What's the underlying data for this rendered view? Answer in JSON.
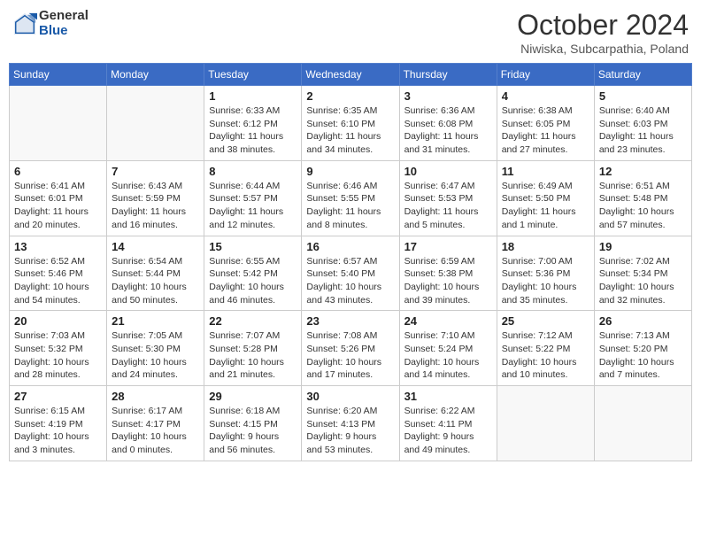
{
  "header": {
    "logo_general": "General",
    "logo_blue": "Blue",
    "month_title": "October 2024",
    "subtitle": "Niwiska, Subcarpathia, Poland"
  },
  "days_of_week": [
    "Sunday",
    "Monday",
    "Tuesday",
    "Wednesday",
    "Thursday",
    "Friday",
    "Saturday"
  ],
  "weeks": [
    [
      {
        "day": "",
        "info": ""
      },
      {
        "day": "",
        "info": ""
      },
      {
        "day": "1",
        "sunrise": "Sunrise: 6:33 AM",
        "sunset": "Sunset: 6:12 PM",
        "daylight": "Daylight: 11 hours and 38 minutes."
      },
      {
        "day": "2",
        "sunrise": "Sunrise: 6:35 AM",
        "sunset": "Sunset: 6:10 PM",
        "daylight": "Daylight: 11 hours and 34 minutes."
      },
      {
        "day": "3",
        "sunrise": "Sunrise: 6:36 AM",
        "sunset": "Sunset: 6:08 PM",
        "daylight": "Daylight: 11 hours and 31 minutes."
      },
      {
        "day": "4",
        "sunrise": "Sunrise: 6:38 AM",
        "sunset": "Sunset: 6:05 PM",
        "daylight": "Daylight: 11 hours and 27 minutes."
      },
      {
        "day": "5",
        "sunrise": "Sunrise: 6:40 AM",
        "sunset": "Sunset: 6:03 PM",
        "daylight": "Daylight: 11 hours and 23 minutes."
      }
    ],
    [
      {
        "day": "6",
        "sunrise": "Sunrise: 6:41 AM",
        "sunset": "Sunset: 6:01 PM",
        "daylight": "Daylight: 11 hours and 20 minutes."
      },
      {
        "day": "7",
        "sunrise": "Sunrise: 6:43 AM",
        "sunset": "Sunset: 5:59 PM",
        "daylight": "Daylight: 11 hours and 16 minutes."
      },
      {
        "day": "8",
        "sunrise": "Sunrise: 6:44 AM",
        "sunset": "Sunset: 5:57 PM",
        "daylight": "Daylight: 11 hours and 12 minutes."
      },
      {
        "day": "9",
        "sunrise": "Sunrise: 6:46 AM",
        "sunset": "Sunset: 5:55 PM",
        "daylight": "Daylight: 11 hours and 8 minutes."
      },
      {
        "day": "10",
        "sunrise": "Sunrise: 6:47 AM",
        "sunset": "Sunset: 5:53 PM",
        "daylight": "Daylight: 11 hours and 5 minutes."
      },
      {
        "day": "11",
        "sunrise": "Sunrise: 6:49 AM",
        "sunset": "Sunset: 5:50 PM",
        "daylight": "Daylight: 11 hours and 1 minute."
      },
      {
        "day": "12",
        "sunrise": "Sunrise: 6:51 AM",
        "sunset": "Sunset: 5:48 PM",
        "daylight": "Daylight: 10 hours and 57 minutes."
      }
    ],
    [
      {
        "day": "13",
        "sunrise": "Sunrise: 6:52 AM",
        "sunset": "Sunset: 5:46 PM",
        "daylight": "Daylight: 10 hours and 54 minutes."
      },
      {
        "day": "14",
        "sunrise": "Sunrise: 6:54 AM",
        "sunset": "Sunset: 5:44 PM",
        "daylight": "Daylight: 10 hours and 50 minutes."
      },
      {
        "day": "15",
        "sunrise": "Sunrise: 6:55 AM",
        "sunset": "Sunset: 5:42 PM",
        "daylight": "Daylight: 10 hours and 46 minutes."
      },
      {
        "day": "16",
        "sunrise": "Sunrise: 6:57 AM",
        "sunset": "Sunset: 5:40 PM",
        "daylight": "Daylight: 10 hours and 43 minutes."
      },
      {
        "day": "17",
        "sunrise": "Sunrise: 6:59 AM",
        "sunset": "Sunset: 5:38 PM",
        "daylight": "Daylight: 10 hours and 39 minutes."
      },
      {
        "day": "18",
        "sunrise": "Sunrise: 7:00 AM",
        "sunset": "Sunset: 5:36 PM",
        "daylight": "Daylight: 10 hours and 35 minutes."
      },
      {
        "day": "19",
        "sunrise": "Sunrise: 7:02 AM",
        "sunset": "Sunset: 5:34 PM",
        "daylight": "Daylight: 10 hours and 32 minutes."
      }
    ],
    [
      {
        "day": "20",
        "sunrise": "Sunrise: 7:03 AM",
        "sunset": "Sunset: 5:32 PM",
        "daylight": "Daylight: 10 hours and 28 minutes."
      },
      {
        "day": "21",
        "sunrise": "Sunrise: 7:05 AM",
        "sunset": "Sunset: 5:30 PM",
        "daylight": "Daylight: 10 hours and 24 minutes."
      },
      {
        "day": "22",
        "sunrise": "Sunrise: 7:07 AM",
        "sunset": "Sunset: 5:28 PM",
        "daylight": "Daylight: 10 hours and 21 minutes."
      },
      {
        "day": "23",
        "sunrise": "Sunrise: 7:08 AM",
        "sunset": "Sunset: 5:26 PM",
        "daylight": "Daylight: 10 hours and 17 minutes."
      },
      {
        "day": "24",
        "sunrise": "Sunrise: 7:10 AM",
        "sunset": "Sunset: 5:24 PM",
        "daylight": "Daylight: 10 hours and 14 minutes."
      },
      {
        "day": "25",
        "sunrise": "Sunrise: 7:12 AM",
        "sunset": "Sunset: 5:22 PM",
        "daylight": "Daylight: 10 hours and 10 minutes."
      },
      {
        "day": "26",
        "sunrise": "Sunrise: 7:13 AM",
        "sunset": "Sunset: 5:20 PM",
        "daylight": "Daylight: 10 hours and 7 minutes."
      }
    ],
    [
      {
        "day": "27",
        "sunrise": "Sunrise: 6:15 AM",
        "sunset": "Sunset: 4:19 PM",
        "daylight": "Daylight: 10 hours and 3 minutes."
      },
      {
        "day": "28",
        "sunrise": "Sunrise: 6:17 AM",
        "sunset": "Sunset: 4:17 PM",
        "daylight": "Daylight: 10 hours and 0 minutes."
      },
      {
        "day": "29",
        "sunrise": "Sunrise: 6:18 AM",
        "sunset": "Sunset: 4:15 PM",
        "daylight": "Daylight: 9 hours and 56 minutes."
      },
      {
        "day": "30",
        "sunrise": "Sunrise: 6:20 AM",
        "sunset": "Sunset: 4:13 PM",
        "daylight": "Daylight: 9 hours and 53 minutes."
      },
      {
        "day": "31",
        "sunrise": "Sunrise: 6:22 AM",
        "sunset": "Sunset: 4:11 PM",
        "daylight": "Daylight: 9 hours and 49 minutes."
      },
      {
        "day": "",
        "info": ""
      },
      {
        "day": "",
        "info": ""
      }
    ]
  ]
}
